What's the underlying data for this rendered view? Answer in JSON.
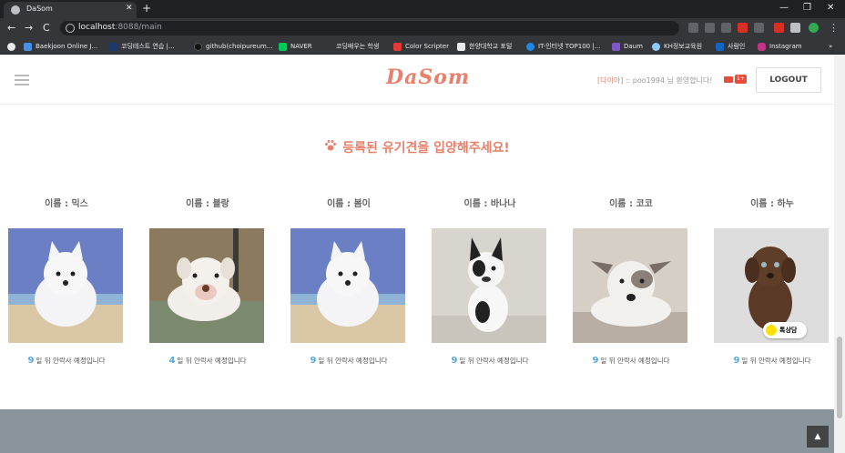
{
  "browser": {
    "tab_title": "DaSom",
    "tab_close": "✕",
    "new_tab": "+",
    "url_host": "localhost",
    "url_rest": ":8088/main",
    "window_controls": {
      "minimize": "—",
      "restore": "❐",
      "close": "✕"
    },
    "nav": {
      "back": "←",
      "forward": "→",
      "reload": "C"
    },
    "bookmarks": [
      {
        "label": "Baekjoon Online J...",
        "icon_color": "#4a90e2",
        "icon": "baekjoon-icon"
      },
      {
        "label": "코딩테스트 연습 |...",
        "icon_color": "#1b3a6b",
        "icon": "programmers-icon"
      },
      {
        "label": "github(choipureum...",
        "icon_color": "#111111",
        "icon": "github-icon"
      },
      {
        "label": "NAVER",
        "icon_color": "#03c75a",
        "icon": "naver-icon"
      },
      {
        "label": "코딩배우는 학생",
        "icon_color": "#35363a",
        "icon": "blog-icon"
      },
      {
        "label": "Color Scripter",
        "icon_color": "#e53935",
        "icon": "colorscripter-icon"
      },
      {
        "label": "한양대학교 포털",
        "icon_color": "#e8eaed",
        "icon": "university-icon"
      },
      {
        "label": "IT-인터넷 TOP100 |...",
        "icon_color": "#1e88e5",
        "icon": "ranking-icon"
      },
      {
        "label": "Daum",
        "icon_color": "#7e57c2",
        "icon": "daum-icon"
      },
      {
        "label": "KH정보교육원",
        "icon_color": "#90caf9",
        "icon": "kh-icon"
      },
      {
        "label": "사람인",
        "icon_color": "#1565c0",
        "icon": "saramin-icon"
      },
      {
        "label": "Instagram",
        "icon_color": "#c13584",
        "icon": "instagram-icon"
      }
    ],
    "more_bookmarks": "»"
  },
  "header": {
    "logo": "DaSom",
    "grade": "[다이아]",
    "welcome_text": ":: poo1994 님 환영합니다!",
    "mail_badge": "1+",
    "logout_label": "LOGOUT"
  },
  "main": {
    "headline": "등록된 유기견을 입양해주세요!",
    "days_suffix": "일 뒤 안락사 예정입니다",
    "dogs": [
      {
        "name": "이름 : 믹스",
        "days": "9",
        "photo": "samoyed-puppy-beach",
        "colors": {
          "bg": "#6b7fc4",
          "dog": "#f4f4f6",
          "ground": "#d9c7a6"
        }
      },
      {
        "name": "이름 : 블랑",
        "days": "4",
        "photo": "white-bulldog-lying",
        "colors": {
          "bg": "#8c7a5e",
          "dog": "#f2efea",
          "ground": "#7b8a6e"
        }
      },
      {
        "name": "이름 : 봄이",
        "days": "9",
        "photo": "samoyed-puppy-beach",
        "colors": {
          "bg": "#6b7fc4",
          "dog": "#f4f4f6",
          "ground": "#d9c7a6"
        }
      },
      {
        "name": "이름 : 바나나",
        "days": "9",
        "photo": "french-bulldog-sitting",
        "colors": {
          "bg": "#d8d4ce",
          "dog": "#f7f7f7",
          "ground": "#c9c4bc"
        }
      },
      {
        "name": "이름 : 코코",
        "days": "9",
        "photo": "jack-russell-lying",
        "colors": {
          "bg": "#d6cfc6",
          "dog": "#f3f1ee",
          "ground": "#b8aea4"
        }
      },
      {
        "name": "이름 : 하누",
        "days": "9",
        "photo": "brown-labrador-puppy",
        "colors": {
          "bg": "#cfcfcf",
          "dog": "#5a3a27",
          "ground": "#e6e6e6"
        }
      }
    ]
  },
  "kakao_chat": {
    "label": "톡상담"
  },
  "scroll_top": {
    "label": "▲"
  }
}
